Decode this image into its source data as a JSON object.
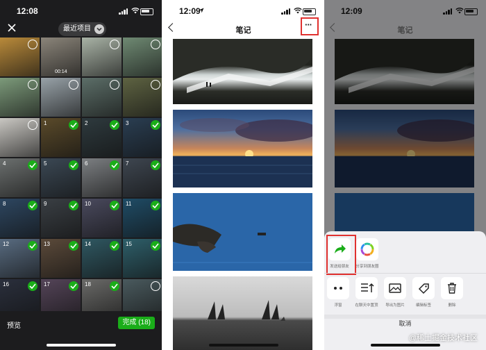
{
  "panel1": {
    "time": "12:08",
    "album_title": "最近项目",
    "grid_cells": [
      {
        "num": "",
        "state": "ring",
        "dur": "",
        "bg": "#b98a3a"
      },
      {
        "num": "",
        "state": "none",
        "dur": "00:14",
        "bg": "#8b857a"
      },
      {
        "num": "",
        "state": "ring",
        "dur": "",
        "bg": "#a9b3a6"
      },
      {
        "num": "",
        "state": "ring",
        "dur": "",
        "bg": "#6f8a73"
      },
      {
        "num": "",
        "state": "ring",
        "dur": "",
        "bg": "#7c9a7a"
      },
      {
        "num": "",
        "state": "ring",
        "dur": "",
        "bg": "#98a2a8"
      },
      {
        "num": "",
        "state": "ring",
        "dur": "",
        "bg": "#5c6e68"
      },
      {
        "num": "",
        "state": "ring",
        "dur": "",
        "bg": "#5e6342"
      },
      {
        "num": "",
        "state": "ring",
        "dur": "",
        "bg": "#c9c7c2"
      },
      {
        "num": "1",
        "state": "check",
        "dur": "",
        "bg": "#5a4a2a"
      },
      {
        "num": "2",
        "state": "check",
        "dur": "",
        "bg": "#2e3a3e"
      },
      {
        "num": "3",
        "state": "check",
        "dur": "",
        "bg": "#2a3e52"
      },
      {
        "num": "4",
        "state": "check",
        "dur": "",
        "bg": "#6b6f6e"
      },
      {
        "num": "5",
        "state": "check",
        "dur": "",
        "bg": "#3b4854"
      },
      {
        "num": "6",
        "state": "check",
        "dur": "",
        "bg": "#7c7f82"
      },
      {
        "num": "7",
        "state": "check",
        "dur": "",
        "bg": "#3e4650"
      },
      {
        "num": "8",
        "state": "check",
        "dur": "",
        "bg": "#2d4660"
      },
      {
        "num": "9",
        "state": "check",
        "dur": "",
        "bg": "#3a3f44"
      },
      {
        "num": "10",
        "state": "check",
        "dur": "",
        "bg": "#4a4a5e"
      },
      {
        "num": "11",
        "state": "check",
        "dur": "",
        "bg": "#1f4c66"
      },
      {
        "num": "12",
        "state": "check",
        "dur": "",
        "bg": "#586b80"
      },
      {
        "num": "13",
        "state": "check",
        "dur": "",
        "bg": "#5b4a3a"
      },
      {
        "num": "14",
        "state": "check",
        "dur": "",
        "bg": "#2f5862"
      },
      {
        "num": "15",
        "state": "check",
        "dur": "",
        "bg": "#2e5f6a"
      },
      {
        "num": "16",
        "state": "check",
        "dur": "",
        "bg": "#2a2f3c"
      },
      {
        "num": "17",
        "state": "check",
        "dur": "",
        "bg": "#544458"
      },
      {
        "num": "18",
        "state": "check",
        "dur": "",
        "bg": "#6a6a68"
      },
      {
        "num": "",
        "state": "ring",
        "dur": "",
        "bg": "#4a5a5e"
      }
    ],
    "preview_label": "预览",
    "done_label": "完成 (18)"
  },
  "panel2": {
    "time": "12:09",
    "title": "笔记",
    "more_glyph": "···"
  },
  "panel3": {
    "time": "12:09",
    "title": "笔记",
    "share_items": [
      {
        "label": "发送给朋友"
      },
      {
        "label": "分享到朋友圈"
      }
    ],
    "action_items": [
      {
        "label": "浮窗"
      },
      {
        "label": "在聊天中置顶"
      },
      {
        "label": "导出为图片"
      },
      {
        "label": "编辑标签"
      },
      {
        "label": "删除"
      }
    ],
    "cancel_label": "取消",
    "watermark": "@稀土掘金技术社区"
  },
  "colors": {
    "wechat_green": "#1aad19",
    "highlight_red": "#e0312f",
    "dark_bg": "#1c1c1e"
  }
}
